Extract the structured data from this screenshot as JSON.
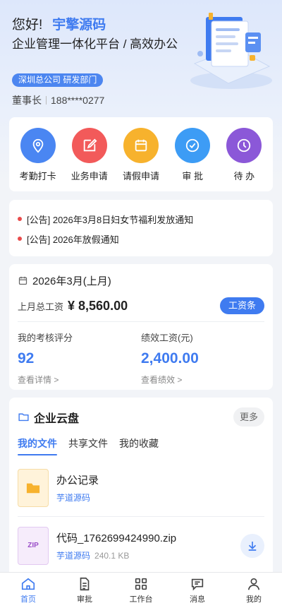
{
  "header": {
    "greeting": "您好!",
    "brand": "宇擎源码",
    "subtitle": "企业管理一体化平台 / 高效办公",
    "department": "深圳总公司 研发部门",
    "role": "董事长",
    "phone": "188****0277"
  },
  "quick_actions": [
    {
      "label": "考勤打卡",
      "icon": "location-pin-icon",
      "color": "#4a86f2"
    },
    {
      "label": "业务申请",
      "icon": "edit-icon",
      "color": "#f25a5a"
    },
    {
      "label": "请假申请",
      "icon": "calendar-icon",
      "color": "#f7b22d"
    },
    {
      "label": "审 批",
      "icon": "check-circle-icon",
      "color": "#3d9cf5"
    },
    {
      "label": "待 办",
      "icon": "clock-icon",
      "color": "#8b58d8"
    }
  ],
  "notices": [
    {
      "text": "[公告] 2026年3月8日妇女节福利发放通知"
    },
    {
      "text": "[公告] 2026年放假通知"
    }
  ],
  "salary": {
    "period": "2026年3月(上月)",
    "total_label": "上月总工资",
    "total_value": "¥ 8,560.00",
    "slip_button": "工资条",
    "score_label": "我的考核评分",
    "score_value": "92",
    "score_link": "查看详情 >",
    "perf_label": "绩效工资(元)",
    "perf_value": "2,400.00",
    "perf_link": "查看绩效 >"
  },
  "cloud": {
    "title": "企业云盘",
    "more": "更多",
    "tabs": [
      "我的文件",
      "共享文件",
      "我的收藏"
    ],
    "active_tab": 0,
    "files": [
      {
        "name": "办公记录",
        "owner": "芋道源码",
        "size": "",
        "icon": "folder-icon"
      },
      {
        "name": "代码_1762699424990.zip",
        "owner": "芋道源码",
        "size": "240.1 KB",
        "icon": "zip-icon",
        "badge": "ZIP"
      }
    ]
  },
  "tabbar": [
    {
      "label": "首页",
      "icon": "home-icon",
      "active": true
    },
    {
      "label": "审批",
      "icon": "document-icon",
      "active": false
    },
    {
      "label": "工作台",
      "icon": "grid-icon",
      "active": false
    },
    {
      "label": "消息",
      "icon": "message-icon",
      "active": false
    },
    {
      "label": "我的",
      "icon": "user-icon",
      "active": false
    }
  ],
  "colors": {
    "accent": "#3f7bf0",
    "notice_dot": "#e94b4b"
  }
}
